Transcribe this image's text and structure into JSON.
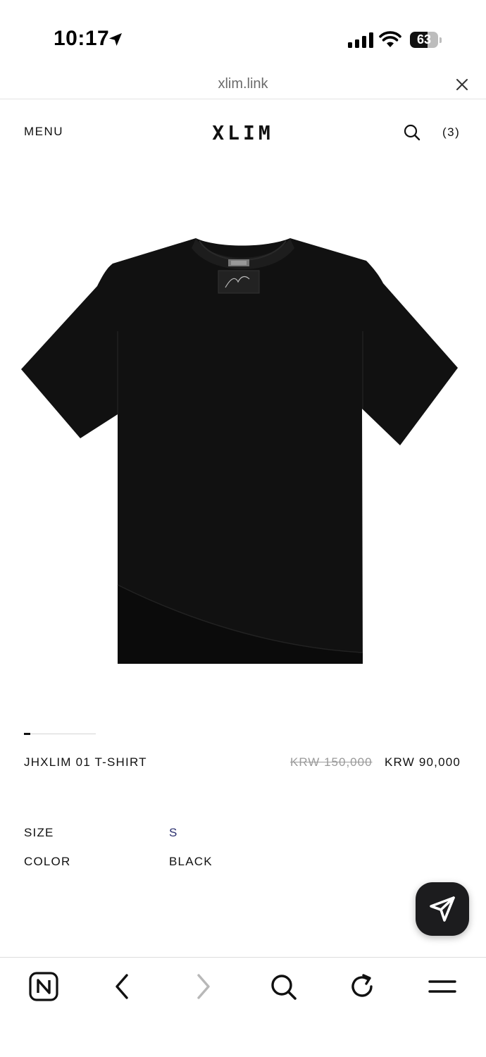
{
  "status_bar": {
    "time": "10:17",
    "location_icon": "location-arrow-icon",
    "signal_icon": "cellular-signal-icon",
    "wifi_icon": "wifi-icon",
    "battery_level": 63,
    "battery_text": "63"
  },
  "browser": {
    "url": "xlim.link",
    "close_icon": "close-icon"
  },
  "header": {
    "menu_label": "MENU",
    "logo": "XLIM",
    "search_icon": "search-icon",
    "cart_label": "(3)"
  },
  "product": {
    "image": "black-t-shirt-image",
    "carousel_position": 1,
    "name": "JHXLIM 01 T-SHIRT",
    "original_price": "KRW 150,000",
    "sale_price": "KRW 90,000",
    "options": {
      "size_label": "SIZE",
      "size_value": "S",
      "color_label": "COLOR",
      "color_value": "BLACK"
    }
  },
  "floating_button": {
    "icon": "send-icon"
  },
  "toolbar": {
    "items": [
      "naver-home-icon",
      "back-icon",
      "forward-icon",
      "search-icon",
      "refresh-icon",
      "menu-icon"
    ]
  },
  "colors": {
    "text": "#111111",
    "muted": "#9a9a9a",
    "size_value": "#2a2f6e",
    "fab": "#1c1c1e"
  }
}
